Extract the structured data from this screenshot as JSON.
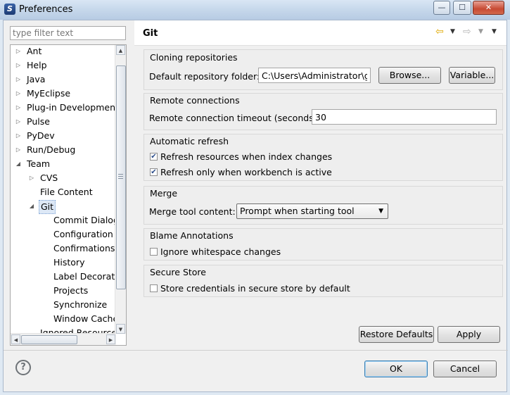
{
  "window": {
    "title": "Preferences",
    "controls": {
      "minimize": "—",
      "maximize": "☐",
      "close": "✕"
    }
  },
  "filter": {
    "placeholder": "type filter text"
  },
  "tree": {
    "items": [
      {
        "label": "Ant",
        "expander": "closed"
      },
      {
        "label": "Help",
        "expander": "closed"
      },
      {
        "label": "Java",
        "expander": "closed"
      },
      {
        "label": "MyEclipse",
        "expander": "closed"
      },
      {
        "label": "Plug-in Development",
        "expander": "closed"
      },
      {
        "label": "Pulse",
        "expander": "closed"
      },
      {
        "label": "PyDev",
        "expander": "closed"
      },
      {
        "label": "Run/Debug",
        "expander": "closed"
      },
      {
        "label": "Team",
        "expander": "open"
      },
      {
        "label": "CVS",
        "expander": "closed"
      },
      {
        "label": "File Content",
        "expander": "none"
      },
      {
        "label": "Git",
        "expander": "open",
        "selected": true
      },
      {
        "label": "Commit Dialog",
        "expander": "none"
      },
      {
        "label": "Configuration",
        "expander": "none"
      },
      {
        "label": "Confirmations and Warnings",
        "expander": "none"
      },
      {
        "label": "History",
        "expander": "none"
      },
      {
        "label": "Label Decorations",
        "expander": "none"
      },
      {
        "label": "Projects",
        "expander": "none"
      },
      {
        "label": "Synchronize",
        "expander": "none"
      },
      {
        "label": "Window Cache",
        "expander": "none"
      },
      {
        "label": "Ignored Resources",
        "expander": "none"
      }
    ]
  },
  "page": {
    "title": "Git",
    "nav_icons": [
      "back-arrow-icon",
      "forward-arrow-icon",
      "view-menu-icon"
    ]
  },
  "cloning": {
    "heading": "Cloning repositories",
    "folder_label": "Default repository folder:",
    "folder_value": "C:\\Users\\Administrator\\git",
    "browse_label": "Browse...",
    "variable_label": "Variable..."
  },
  "remote": {
    "heading": "Remote connections",
    "timeout_label": "Remote connection timeout (seconds):",
    "timeout_value": "30"
  },
  "refresh": {
    "heading": "Automatic refresh",
    "options": [
      {
        "label": "Refresh resources when index changes",
        "checked": true
      },
      {
        "label": "Refresh only when workbench is active",
        "checked": true
      }
    ]
  },
  "merge": {
    "heading": "Merge",
    "tool_label": "Merge tool content:",
    "tool_value": "Prompt when starting tool"
  },
  "blame": {
    "heading": "Blame Annotations",
    "options": [
      {
        "label": "Ignore whitespace changes",
        "checked": false
      }
    ]
  },
  "secure": {
    "heading": "Secure Store",
    "options": [
      {
        "label": "Store credentials in secure store by default",
        "checked": false
      }
    ]
  },
  "page_buttons": {
    "restore_label": "Restore Defaults",
    "apply_label": "Apply"
  },
  "dialog_buttons": {
    "ok_label": "OK",
    "cancel_label": "Cancel"
  },
  "help": {
    "icon_glyph": "?"
  }
}
